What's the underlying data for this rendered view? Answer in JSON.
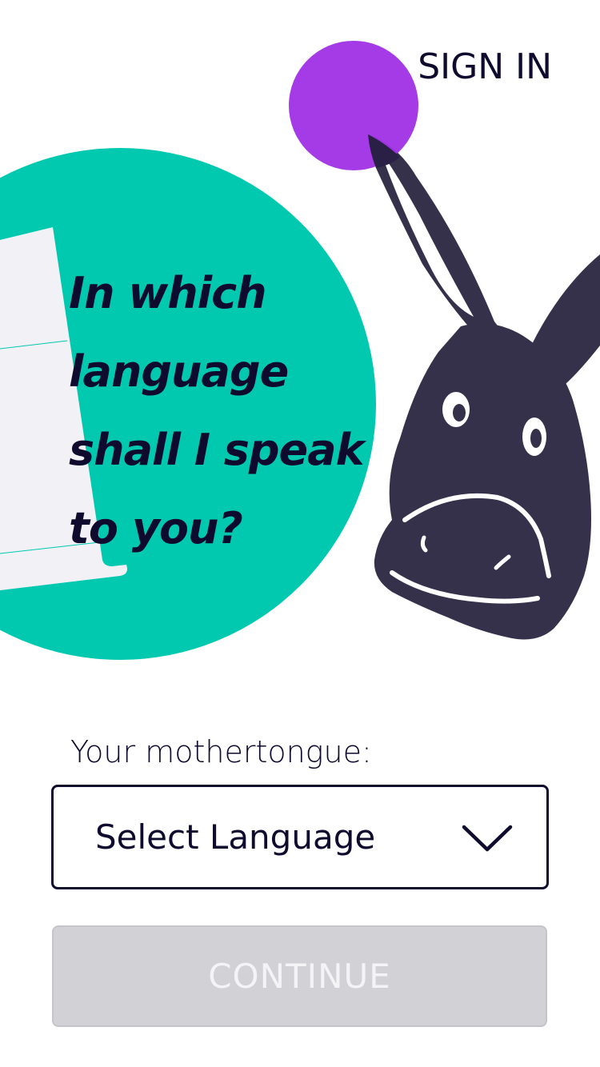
{
  "header": {
    "sign_in_label": "SIGN IN"
  },
  "hero": {
    "question_lines": [
      "In which",
      "language",
      "shall I speak",
      "to you?"
    ],
    "colors": {
      "circle": "#00c9b0",
      "dot": "#a033e5",
      "paper": "#f1f1f6",
      "mascot": "#36314a"
    },
    "mascot_icon": "donkey-illustration"
  },
  "form": {
    "label": "Your mothertongue:",
    "select": {
      "value": "Select Language",
      "icon": "chevron-down-icon"
    },
    "continue_label": "CONTINUE",
    "continue_enabled": false
  }
}
